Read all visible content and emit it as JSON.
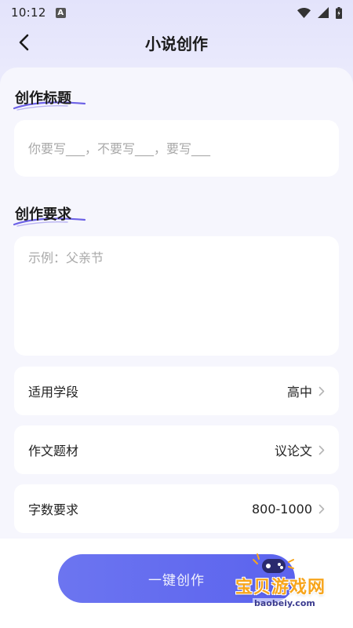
{
  "status_bar": {
    "time": "10:12",
    "notification_icon": "a-notification-icon",
    "icons": [
      "wifi-icon",
      "signal-icon",
      "battery-icon"
    ]
  },
  "nav": {
    "title": "小说创作",
    "back_icon": "chevron-left-icon"
  },
  "title_section": {
    "heading": "创作标题",
    "placeholder": "你要写___，不要写___，要写___",
    "value": ""
  },
  "requirement_section": {
    "heading": "创作要求",
    "placeholder": "示例：父亲节",
    "value": ""
  },
  "options": [
    {
      "label": "适用学段",
      "value": "高中"
    },
    {
      "label": "作文题材",
      "value": "议论文"
    },
    {
      "label": "字数要求",
      "value": "800-1000"
    }
  ],
  "generate_button": {
    "label": "一键创作"
  },
  "watermark": {
    "text": "宝贝游戏网",
    "url": "baobeiy.com"
  },
  "colors": {
    "accent": "#5b63ee",
    "heading_underline": "#6d62e6",
    "watermark": "#f7a51c"
  }
}
